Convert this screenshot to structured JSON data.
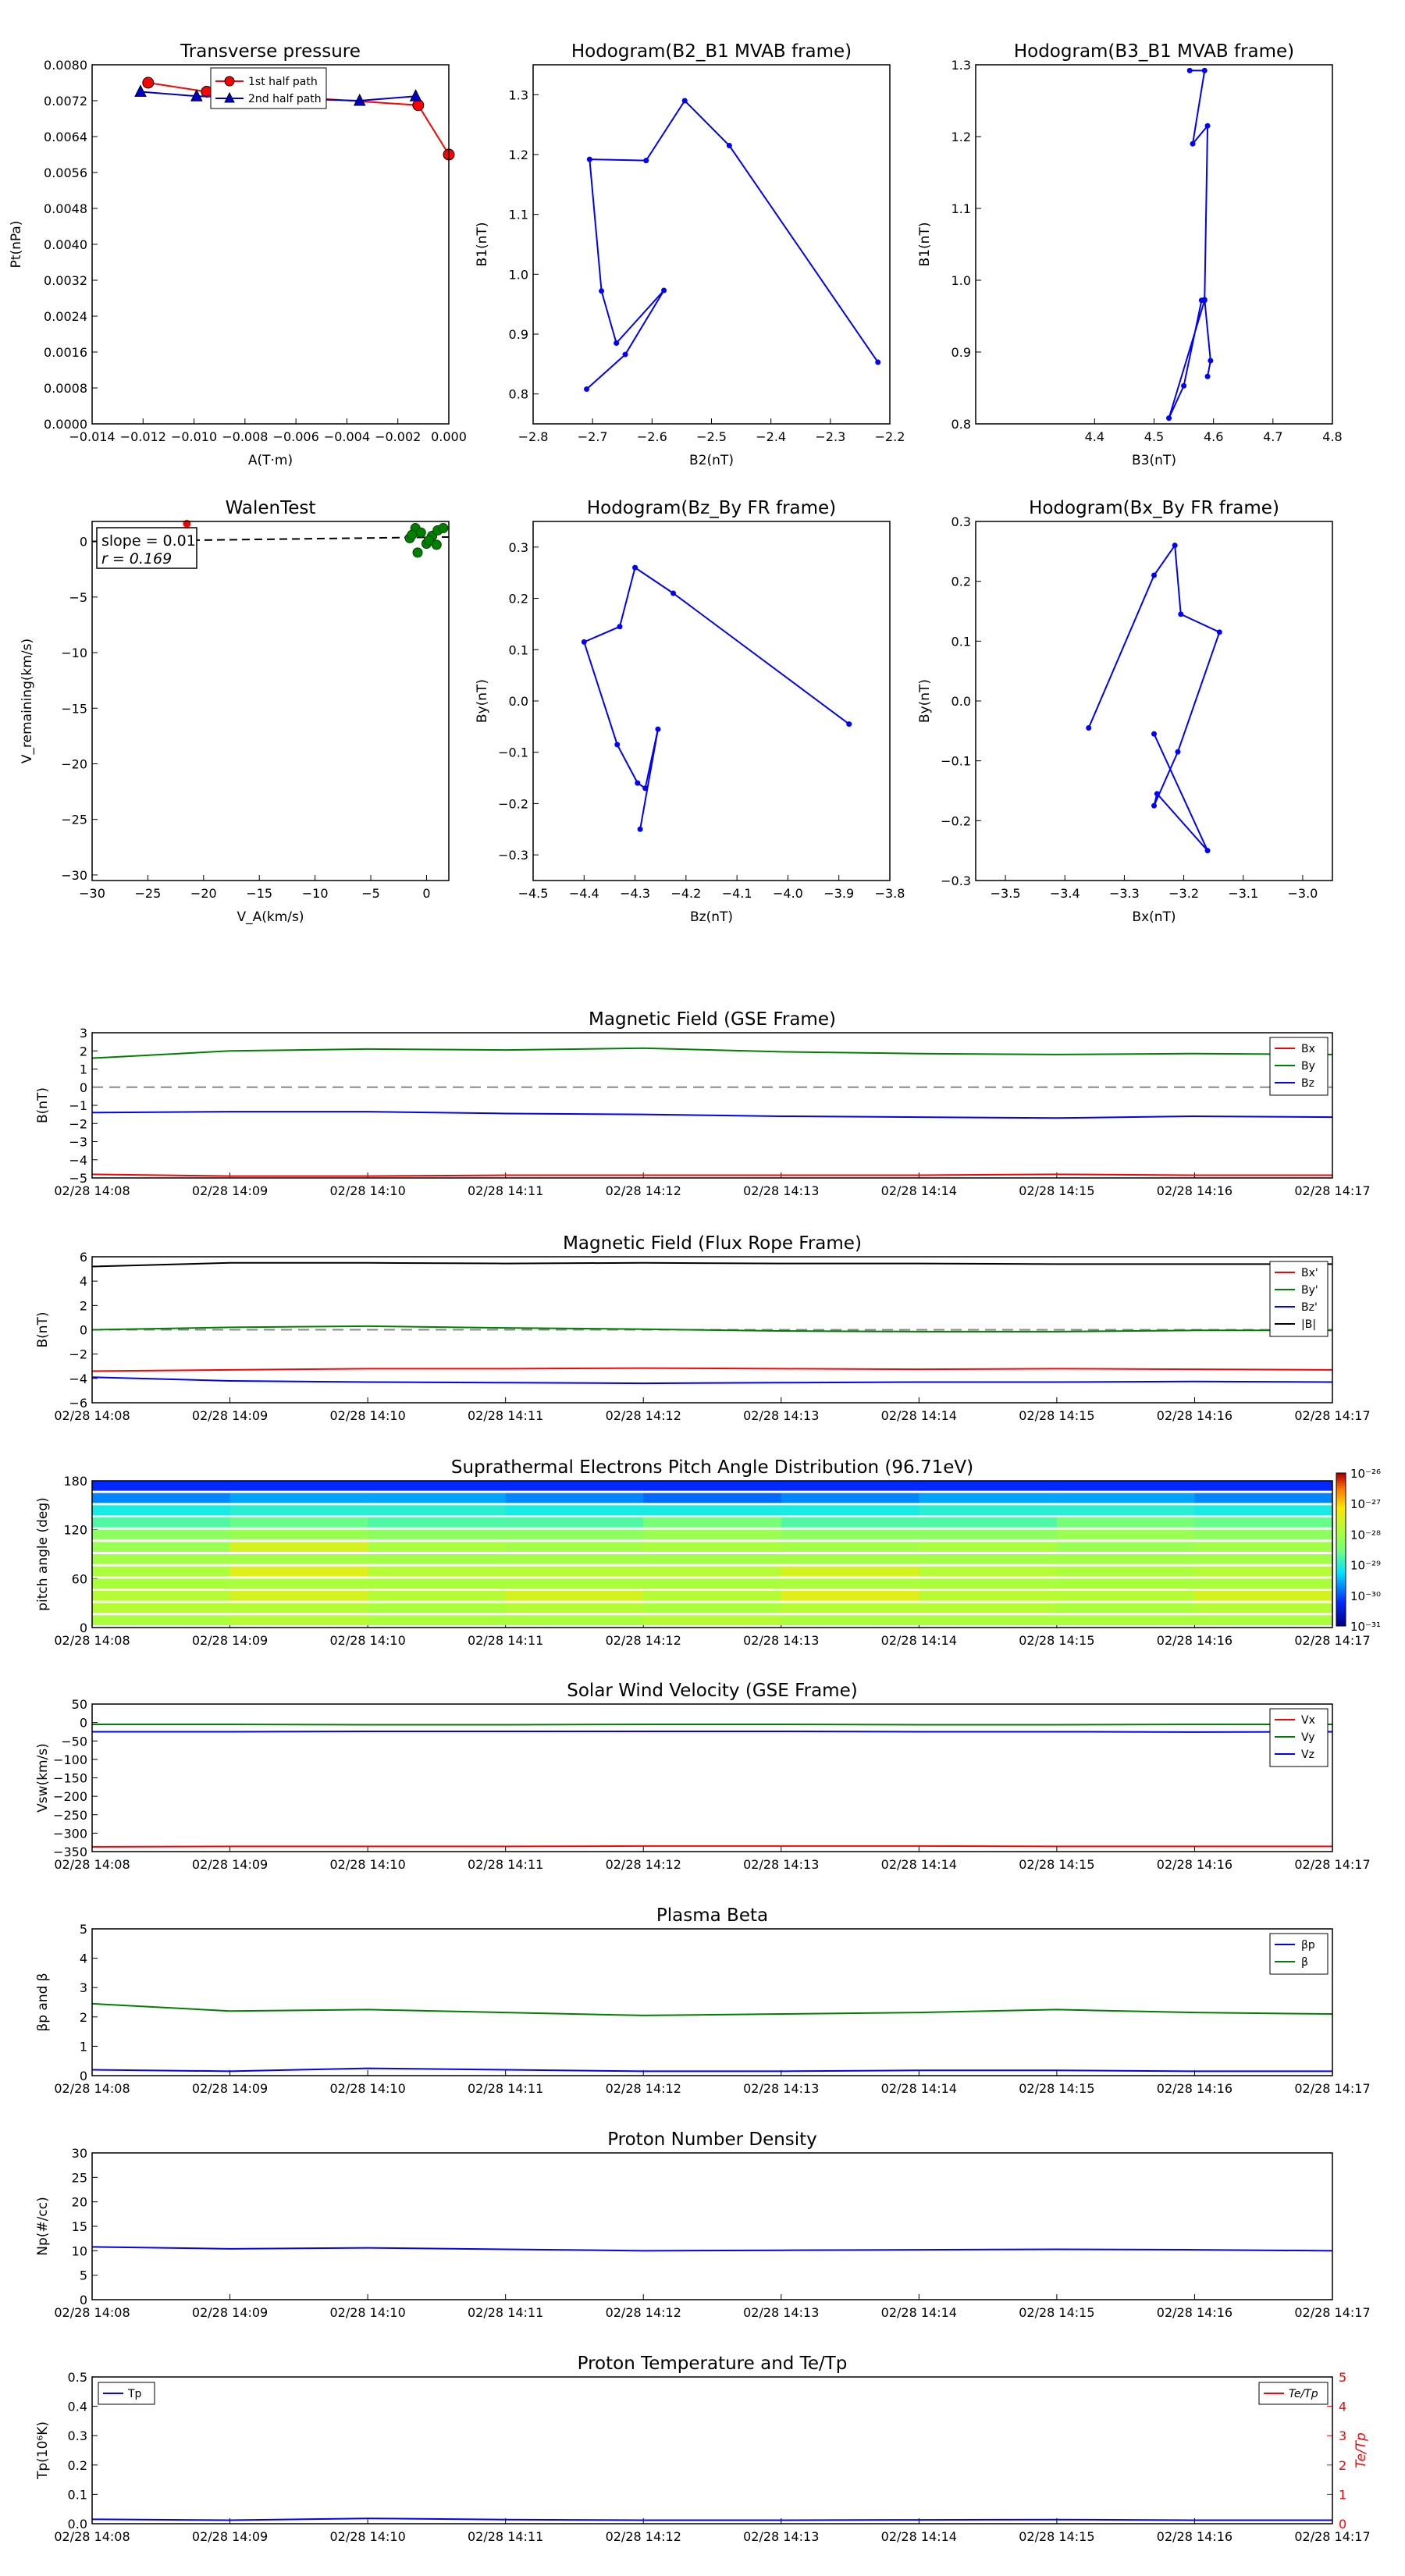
{
  "tick_labels": {
    "time": [
      "02/28 14:08",
      "02/28 14:09",
      "02/28 14:10",
      "02/28 14:11",
      "02/28 14:12",
      "02/28 14:13",
      "02/28 14:14",
      "02/28 14:15",
      "02/28 14:16",
      "02/28 14:17"
    ]
  },
  "chart_data": [
    {
      "id": "transverse_pressure",
      "type": "line",
      "title": "Transverse pressure",
      "xlabel": "A(T·m)",
      "ylabel": "Pt(nPa)",
      "xlim": [
        -0.014,
        0.0
      ],
      "ylim": [
        0.0,
        0.008
      ],
      "xticks": [
        "−0.014",
        "−0.012",
        "−0.010",
        "−0.008",
        "−0.006",
        "−0.004",
        "−0.002",
        "0.000"
      ],
      "yticks": [
        "0.0000",
        "0.0008",
        "0.0016",
        "0.0024",
        "0.0032",
        "0.0040",
        "0.0048",
        "0.0056",
        "0.0064",
        "0.0072",
        "0.0080"
      ],
      "legend": "top-center",
      "series": [
        {
          "name": "1st half path",
          "color": "#ff0000",
          "marker": "circle",
          "x": [
            -0.0118,
            -0.0095,
            -0.0065,
            -0.0012,
            0.0
          ],
          "y": [
            0.0076,
            0.0074,
            0.0073,
            0.0071,
            0.006
          ]
        },
        {
          "name": "2nd half path",
          "color": "#0000cc",
          "marker": "triangle",
          "x": [
            -0.0121,
            -0.0099,
            -0.0035,
            -0.0013
          ],
          "y": [
            0.0074,
            0.0073,
            0.0072,
            0.0073
          ]
        }
      ]
    },
    {
      "id": "hodogram_b2_b1",
      "type": "line",
      "title": "Hodogram(B2_B1 MVAB frame)",
      "xlabel": "B2(nT)",
      "ylabel": "B1(nT)",
      "xlim": [
        -2.8,
        -2.2
      ],
      "ylim": [
        0.75,
        1.35
      ],
      "xticks": [
        "−2.8",
        "−2.7",
        "−2.6",
        "−2.5",
        "−2.4",
        "−2.3",
        "−2.2"
      ],
      "yticks": [
        "0.8",
        "0.9",
        "1.0",
        "1.1",
        "1.2",
        "1.3"
      ],
      "x": [
        -2.22,
        -2.47,
        -2.545,
        -2.61,
        -2.705,
        -2.685,
        -2.66,
        -2.58,
        -2.645,
        -2.71
      ],
      "y": [
        0.853,
        1.215,
        1.29,
        1.19,
        1.192,
        0.972,
        0.885,
        0.973,
        0.866,
        0.808
      ]
    },
    {
      "id": "hodogram_b3_b1",
      "type": "line",
      "title": "Hodogram(B3_B1 MVAB frame)",
      "xlabel": "B3(nT)",
      "ylabel": "B1(nT)",
      "xlim": [
        4.2,
        4.8
      ],
      "ylim": [
        0.8,
        1.3
      ],
      "xticks": [
        "4.4",
        "4.5",
        "4.6",
        "4.7",
        "4.8"
      ],
      "yticks": [
        "0.8",
        "0.9",
        "1.0",
        "1.1",
        "1.2",
        "1.3"
      ],
      "x": [
        4.59,
        4.595,
        4.585,
        4.58,
        4.55,
        4.525,
        4.585,
        4.59,
        4.565,
        4.585,
        4.56
      ],
      "y": [
        0.866,
        0.888,
        0.973,
        0.972,
        0.853,
        0.808,
        0.972,
        1.215,
        1.19,
        1.292,
        1.292
      ]
    },
    {
      "id": "walen_test",
      "type": "scatter",
      "title": "WalenTest",
      "xlabel": "V_A(km/s)",
      "ylabel": "V_remaining(km/s)",
      "xlim": [
        -30,
        2
      ],
      "ylim": [
        -30.5,
        1.8
      ],
      "xticks": [
        "−30",
        "−25",
        "−20",
        "−15",
        "−10",
        "−5",
        "0"
      ],
      "yticks": [
        "−30",
        "−25",
        "−20",
        "−15",
        "−10",
        "−5",
        "0"
      ],
      "annotation": [
        "slope = 0.01",
        "r = 0.169"
      ],
      "points_x": [
        -1.5,
        -1.0,
        -0.5,
        0.0,
        0.5,
        1.0,
        1.5,
        -0.8,
        0.2,
        0.9,
        -1.3
      ],
      "points_y": [
        0.3,
        1.2,
        0.8,
        -0.2,
        0.5,
        1.0,
        1.2,
        -1.0,
        0.1,
        -0.3,
        0.6
      ],
      "fit_x": [
        -30,
        2
      ],
      "fit_y": [
        0.0,
        0.4
      ]
    },
    {
      "id": "hodogram_bz_by",
      "type": "line",
      "title": "Hodogram(Bz_By FR frame)",
      "xlabel": "Bz(nT)",
      "ylabel": "By(nT)",
      "xlim": [
        -4.5,
        -3.8
      ],
      "ylim": [
        -0.35,
        0.35
      ],
      "xticks": [
        "−4.5",
        "−4.4",
        "−4.3",
        "−4.2",
        "−4.1",
        "−4.0",
        "−3.9",
        "−3.8"
      ],
      "yticks": [
        "−0.3",
        "−0.2",
        "−0.1",
        "0.0",
        "0.1",
        "0.2",
        "0.3"
      ],
      "x": [
        -3.88,
        -4.225,
        -4.3,
        -4.33,
        -4.4,
        -4.335,
        -4.295,
        -4.28,
        -4.255,
        -4.29
      ],
      "y": [
        -0.045,
        0.21,
        0.26,
        0.145,
        0.115,
        -0.085,
        -0.16,
        -0.17,
        -0.055,
        -0.25
      ]
    },
    {
      "id": "hodogram_bx_by",
      "type": "line",
      "title": "Hodogram(Bx_By FR frame)",
      "xlabel": "Bx(nT)",
      "ylabel": "By(nT)",
      "xlim": [
        -3.55,
        -2.95
      ],
      "ylim": [
        -0.3,
        0.3
      ],
      "xticks": [
        "−3.5",
        "−3.4",
        "−3.3",
        "−3.2",
        "−3.1",
        "−3.0"
      ],
      "yticks": [
        "−0.3",
        "−0.2",
        "−0.1",
        "0.0",
        "0.1",
        "0.2",
        "0.3"
      ],
      "x": [
        -3.36,
        -3.25,
        -3.215,
        -3.205,
        -3.14,
        -3.21,
        -3.25,
        -3.245,
        -3.16,
        -3.25
      ],
      "y": [
        -0.045,
        0.21,
        0.26,
        0.145,
        0.115,
        -0.085,
        -0.175,
        -0.155,
        -0.25,
        -0.055
      ]
    },
    {
      "id": "mag_gse",
      "type": "line",
      "title": "Magnetic Field (GSE Frame)",
      "ylabel": "B(nT)",
      "ylim": [
        -5,
        3
      ],
      "yticks": [
        "−5",
        "−4",
        "−3",
        "−2",
        "−1",
        "0",
        "1",
        "2",
        "3"
      ],
      "zero_line": true,
      "legend": "top-right",
      "x": [
        0,
        1,
        2,
        3,
        4,
        5,
        6,
        7,
        8,
        9
      ],
      "series": [
        {
          "name": "Bx",
          "color": "#ff0000",
          "values": [
            -4.8,
            -4.9,
            -4.9,
            -4.85,
            -4.85,
            -4.85,
            -4.85,
            -4.8,
            -4.85,
            -4.85
          ]
        },
        {
          "name": "By",
          "color": "#007f00",
          "values": [
            1.6,
            2.0,
            2.1,
            2.05,
            2.15,
            1.95,
            1.85,
            1.8,
            1.85,
            1.8
          ]
        },
        {
          "name": "Bz",
          "color": "#0000ff",
          "values": [
            -1.4,
            -1.35,
            -1.35,
            -1.45,
            -1.5,
            -1.6,
            -1.65,
            -1.7,
            -1.6,
            -1.65
          ]
        }
      ]
    },
    {
      "id": "mag_fr",
      "type": "line",
      "title": "Magnetic Field (Flux Rope Frame)",
      "ylabel": "B(nT)",
      "ylim": [
        -6,
        6
      ],
      "yticks": [
        "−6",
        "−4",
        "−2",
        "0",
        "2",
        "4",
        "6"
      ],
      "zero_line": true,
      "legend": "top-right",
      "x": [
        0,
        1,
        2,
        3,
        4,
        5,
        6,
        7,
        8,
        9
      ],
      "series": [
        {
          "name": "Bx'",
          "color": "#ff0000",
          "values": [
            -3.4,
            -3.3,
            -3.2,
            -3.2,
            -3.15,
            -3.2,
            -3.25,
            -3.2,
            -3.25,
            -3.3
          ]
        },
        {
          "name": "By'",
          "color": "#007f00",
          "values": [
            0.0,
            0.2,
            0.3,
            0.15,
            0.05,
            -0.1,
            -0.15,
            -0.15,
            -0.05,
            -0.05
          ]
        },
        {
          "name": "Bz'",
          "color": "#0000ff",
          "values": [
            -3.9,
            -4.2,
            -4.3,
            -4.35,
            -4.4,
            -4.35,
            -4.3,
            -4.3,
            -4.25,
            -4.3
          ]
        },
        {
          "name": "|B|",
          "color": "#000000",
          "values": [
            5.2,
            5.5,
            5.5,
            5.45,
            5.5,
            5.45,
            5.45,
            5.4,
            5.4,
            5.4
          ]
        }
      ]
    },
    {
      "id": "pad",
      "type": "heatmap",
      "title": "Suprathermal Electrons Pitch Angle Distribution (96.71eV)",
      "ylabel": "pitch angle (deg)",
      "ylim": [
        0,
        180
      ],
      "yticks": [
        "0",
        "60",
        "120",
        "180"
      ],
      "colorbar_ticks": [
        "10⁻²⁶",
        "10⁻²⁷",
        "10⁻²⁸",
        "10⁻²⁹",
        "10⁻³⁰",
        "10⁻³¹"
      ],
      "rows": [
        [
          0.85,
          0.85,
          0.85,
          0.85,
          0.85,
          0.85,
          0.85,
          0.85,
          0.85
        ],
        [
          0.75,
          0.72,
          0.72,
          0.75,
          0.78,
          0.75,
          0.72,
          0.72,
          0.75
        ],
        [
          0.62,
          0.6,
          0.6,
          0.62,
          0.62,
          0.62,
          0.6,
          0.6,
          0.62
        ],
        [
          0.55,
          0.52,
          0.55,
          0.55,
          0.5,
          0.55,
          0.55,
          0.5,
          0.52
        ],
        [
          0.45,
          0.42,
          0.45,
          0.45,
          0.42,
          0.45,
          0.45,
          0.42,
          0.45
        ],
        [
          0.42,
          0.3,
          0.38,
          0.4,
          0.38,
          0.4,
          0.38,
          0.42,
          0.4
        ],
        [
          0.4,
          0.4,
          0.4,
          0.4,
          0.4,
          0.4,
          0.4,
          0.4,
          0.4
        ],
        [
          0.38,
          0.28,
          0.36,
          0.36,
          0.36,
          0.3,
          0.36,
          0.38,
          0.36
        ],
        [
          0.38,
          0.38,
          0.38,
          0.38,
          0.38,
          0.38,
          0.38,
          0.38,
          0.38
        ],
        [
          0.36,
          0.3,
          0.36,
          0.3,
          0.36,
          0.28,
          0.35,
          0.36,
          0.3
        ],
        [
          0.36,
          0.36,
          0.38,
          0.36,
          0.38,
          0.36,
          0.36,
          0.38,
          0.36
        ],
        [
          0.38,
          0.36,
          0.38,
          0.38,
          0.36,
          0.38,
          0.38,
          0.38,
          0.38
        ]
      ]
    },
    {
      "id": "vsw",
      "type": "line",
      "title": "Solar Wind Velocity (GSE Frame)",
      "ylabel": "Vsw(km/s)",
      "ylim": [
        -350,
        50
      ],
      "yticks": [
        "−350",
        "−300",
        "−250",
        "−200",
        "−150",
        "−100",
        "−50",
        "0",
        "50"
      ],
      "legend": "top-right",
      "x": [
        0,
        1,
        2,
        3,
        4,
        5,
        6,
        7,
        8,
        9
      ],
      "series": [
        {
          "name": "Vx",
          "color": "#ff0000",
          "values": [
            -337,
            -336,
            -336,
            -336,
            -335,
            -335,
            -335,
            -336,
            -336,
            -336
          ]
        },
        {
          "name": "Vy",
          "color": "#007f00",
          "values": [
            -5,
            -5,
            -6,
            -6,
            -5,
            -5,
            -6,
            -6,
            -5,
            -5
          ]
        },
        {
          "name": "Vz",
          "color": "#0000ff",
          "values": [
            -25,
            -25,
            -24,
            -24,
            -24,
            -24,
            -25,
            -25,
            -26,
            -25
          ]
        }
      ]
    },
    {
      "id": "beta",
      "type": "line",
      "title": "Plasma Beta",
      "ylabel": "βp and β",
      "ylim": [
        0,
        5
      ],
      "yticks": [
        "0",
        "1",
        "2",
        "3",
        "4",
        "5"
      ],
      "legend": "top-right",
      "x": [
        0,
        1,
        2,
        3,
        4,
        5,
        6,
        7,
        8,
        9
      ],
      "series": [
        {
          "name": "βp",
          "color": "#0000ff",
          "values": [
            0.2,
            0.15,
            0.25,
            0.2,
            0.15,
            0.15,
            0.18,
            0.18,
            0.15,
            0.15
          ]
        },
        {
          "name": "β",
          "color": "#007f00",
          "values": [
            2.45,
            2.2,
            2.25,
            2.15,
            2.05,
            2.1,
            2.15,
            2.25,
            2.15,
            2.1
          ]
        }
      ]
    },
    {
      "id": "density",
      "type": "line",
      "title": "Proton Number Density",
      "ylabel": "Np(#/cc)",
      "ylim": [
        0,
        30
      ],
      "yticks": [
        "0",
        "5",
        "10",
        "15",
        "20",
        "25",
        "30"
      ],
      "x": [
        0,
        1,
        2,
        3,
        4,
        5,
        6,
        7,
        8,
        9
      ],
      "series": [
        {
          "name": "Np",
          "color": "#0000ff",
          "values": [
            10.8,
            10.4,
            10.6,
            10.3,
            10.0,
            10.1,
            10.2,
            10.3,
            10.2,
            10.0
          ]
        }
      ]
    },
    {
      "id": "temperature",
      "type": "line",
      "title": "Proton Temperature and Te/Tp",
      "ylabel": "Tp(10⁶K)",
      "ylabel_right": "Te/Tp",
      "ylim": [
        0,
        0.5
      ],
      "ylim_right": [
        0,
        5
      ],
      "yticks": [
        "0.0",
        "0.1",
        "0.2",
        "0.3",
        "0.4",
        "0.5"
      ],
      "yticks_right": [
        "0",
        "1",
        "2",
        "3",
        "4",
        "5"
      ],
      "x": [
        0,
        1,
        2,
        3,
        4,
        5,
        6,
        7,
        8,
        9
      ],
      "series": [
        {
          "name": "Tp",
          "color": "#0000ff",
          "axis": "left",
          "legend": "top-left",
          "values": [
            0.015,
            0.012,
            0.018,
            0.014,
            0.012,
            0.012,
            0.013,
            0.014,
            0.012,
            0.012
          ]
        },
        {
          "name": "Te/Tp",
          "color": "#ff0000",
          "axis": "right",
          "legend": "top-right",
          "values": []
        }
      ]
    }
  ]
}
